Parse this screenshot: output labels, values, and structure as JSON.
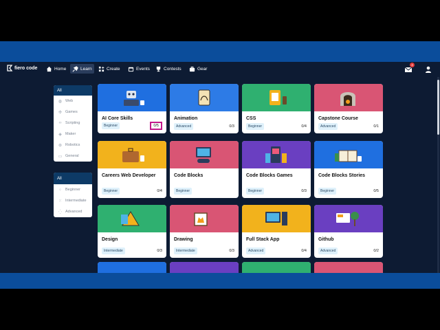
{
  "brand": {
    "logo_text": "fiero code"
  },
  "nav": {
    "items": [
      {
        "label": "Home",
        "icon": "home-icon"
      },
      {
        "label": "Learn",
        "icon": "learn-icon",
        "active": true
      },
      {
        "label": "Create",
        "icon": "create-icon"
      },
      {
        "label": "Events",
        "icon": "calendar-icon"
      },
      {
        "label": "Contests",
        "icon": "trophy-icon"
      },
      {
        "label": "Gear",
        "icon": "gear-icon"
      }
    ],
    "mail_badge": "4"
  },
  "category_filter": {
    "header": "All",
    "items": [
      {
        "label": "Web",
        "icon": "globe-icon"
      },
      {
        "label": "Games",
        "icon": "gamepad-icon"
      },
      {
        "label": "Scripting",
        "icon": "code-icon"
      },
      {
        "label": "Maker",
        "icon": "cube-icon"
      },
      {
        "label": "Robotics",
        "icon": "robot-icon"
      },
      {
        "label": "General",
        "icon": "folder-icon"
      }
    ]
  },
  "level_filter": {
    "header": "All",
    "items": [
      {
        "label": "Beginner",
        "icon": "level-1-icon"
      },
      {
        "label": "Intermediate",
        "icon": "level-2-icon"
      },
      {
        "label": "Advanced",
        "icon": "level-3-icon"
      }
    ]
  },
  "courses": [
    {
      "title": "AI Core Skills",
      "level": "Beginner",
      "progress": "0/5",
      "color": "#1f6fe0",
      "art": "robot"
    },
    {
      "title": "Animation",
      "level": "Advanced",
      "progress": "0/3",
      "color": "#2d7be6",
      "art": "drawing"
    },
    {
      "title": "CSS",
      "level": "Beginner",
      "progress": "0/4",
      "color": "#2fb070",
      "art": "tablet"
    },
    {
      "title": "Capstone Course",
      "level": "Advanced",
      "progress": "0/1",
      "color": "#d95574",
      "art": "arch"
    },
    {
      "title": "Careers Web Developer",
      "level": "Beginner",
      "progress": "0/4",
      "color": "#f2b21c",
      "art": "briefcase"
    },
    {
      "title": "Code Blocks",
      "level": "Beginner",
      "progress": "",
      "color": "#d95574",
      "art": "monitor"
    },
    {
      "title": "Code Blocks Games",
      "level": "Beginner",
      "progress": "0/3",
      "color": "#6a3fc1",
      "art": "arcade"
    },
    {
      "title": "Code Blocks Stories",
      "level": "Beginner",
      "progress": "0/5",
      "color": "#1f6fe0",
      "art": "book"
    },
    {
      "title": "Design",
      "level": "Intermediate",
      "progress": "0/3",
      "color": "#2fb070",
      "art": "ruler"
    },
    {
      "title": "Drawing",
      "level": "Intermediate",
      "progress": "0/3",
      "color": "#d95574",
      "art": "cat"
    },
    {
      "title": "Full Stack App",
      "level": "Advanced",
      "progress": "0/4",
      "color": "#f2b21c",
      "art": "computer"
    },
    {
      "title": "Github",
      "level": "Advanced",
      "progress": "0/2",
      "color": "#6a3fc1",
      "art": "tree"
    },
    {
      "title": "",
      "level": "",
      "progress": "",
      "color": "#1f6fe0",
      "art": ""
    },
    {
      "title": "",
      "level": "",
      "progress": "",
      "color": "#6a3fc1",
      "art": ""
    },
    {
      "title": "",
      "level": "",
      "progress": "",
      "color": "#2fb070",
      "art": ""
    },
    {
      "title": "",
      "level": "",
      "progress": "",
      "color": "#d95574",
      "art": ""
    }
  ]
}
